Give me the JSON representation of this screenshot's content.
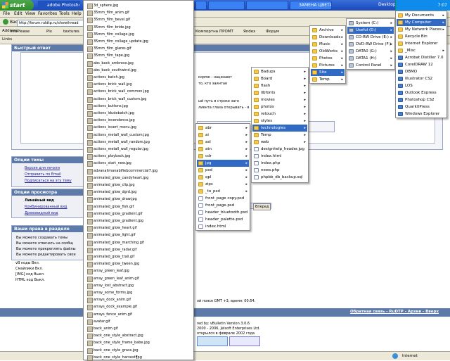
{
  "taskbar": {
    "start_label": "start",
    "buttons": [
      "adobe Photoshop",
      "",
      "",
      "",
      "ЗАМЕНА ЦВЕТА, что..."
    ],
    "desktop_label": "Desktop",
    "clock": "7:07"
  },
  "browser": {
    "menu": [
      "File",
      "Edit",
      "View",
      "Favorites",
      "Tools",
      "Help"
    ],
    "address_label": "Address",
    "address_value": "http://forum.ruldtp.ru/showthread",
    "back_label": "Back",
    "links_label": "Links",
    "links": [
      "infoPlease",
      "Pix",
      "textures",
      "Компортна",
      "ПРОМТ",
      "Яndex",
      "Форум"
    ],
    "status_text": "Internet"
  },
  "forum": {
    "quick_reply": "Быстрый ответ",
    "topic_options": "Опции темы",
    "topic_links": [
      "Версия для печати",
      "Отправить по Email",
      "Подписаться на эту тему"
    ],
    "view_options": "Опции просмотра",
    "view_links": [
      "Линейный вид",
      "Комбинированный вид",
      "Древовидный вид"
    ],
    "rights_title": "Ваши права в разделе",
    "rights": [
      "Вы можете создавать темы",
      "Вы можете отвечать на сообщ",
      "Вы можете прикреплять файлы",
      "Вы можете редактировать свои"
    ],
    "codes": [
      "vB коды Вкл.",
      "Смайлики Вкл.",
      "[IMG] код Выкл.",
      "HTML код Выкл."
    ],
    "text_fragment_1": "корпю - нацинают",
    "text_fragment_2": "то, кто заинтае",
    "text_fragment_3": "ый путь в строке заго",
    "text_fragment_4": "лиента глаза открывать - в",
    "go_button": "Вперед",
    "timezone": "ой поясе GMT +3, время: 00:54.",
    "footer_links": "Обратная связь - RuDTP - Архив - Вверх",
    "powered": "red by: vBulletin Version 3.0.6",
    "copyright": "2000 - 2006, Jelsoft Enterprises Ltd.",
    "opened": "открылся в феврале 2002 года"
  },
  "files": [
    "3d_sphere.jpg",
    "35mm_film_anim.gif",
    "35mm_film_bevel.gif",
    "35mm_film_bride.jpg",
    "35mm_film_collage.jpg",
    "35mm_film_collage_update.jpg",
    "35mm_film_glares.gif",
    "35mm_film_tape.jpg",
    "abs_back_ambroso.jpg",
    "abs_back_southwind.jpg",
    "actions_batch.jpg",
    "actions_brick_wall.jpg",
    "actions_brick_wall_common.jpg",
    "actions_brick_wall_custom.jpg",
    "actions_buttons.jpg",
    "actions_idudebatch.jpg",
    "actions_incendence.jpg",
    "actions_insert_menu.jpg",
    "actions_metall_wall_custom.jpg",
    "actions_metall_wall_random.jpg",
    "actions_metall_wall_regular.jpg",
    "actions_playback.jpg",
    "actions_start_new.jpg",
    "advanalimanabifiebcommercial7.jpg",
    "animated_glow_candyheart.jpg",
    "animated_glow_clip.jpg",
    "animated_glow_dgrd.jpg",
    "animated_glow_draw.jpg",
    "animated_glow_fish.gif",
    "animated_glow_gradient.gif",
    "animated_glow_gradient.jpg",
    "animated_glow_heart.gif",
    "animated_glow_light.gif",
    "animated_glow_marching.gif",
    "animated_glow_radar.gif",
    "animated_glow_trail.gif",
    "animated_glow_tween.jpg",
    "array_green_leaf.jpg",
    "array_green_leaf_anim.gif",
    "array_lost_abstract.jpg",
    "array_some_forms.jpg",
    "arrays_dock_anim.gif",
    "arrays_dock_example.gif",
    "arrays_fence_anim.gif",
    "avatar.gif",
    "back_anim.gif",
    "back_one_style_abstract.jpg",
    "back_one_style_frame_babe.jpg",
    "back_one_style_grass.jpg",
    "back_one_style_harvest.jpg"
  ],
  "menu_psfiles": [
    "abr",
    "ai",
    "asl",
    "atn",
    "cdr",
    "jpg",
    "psd",
    "qpl",
    "zips",
    "_to_psd",
    "front_page copy.psd",
    "front_page.psd",
    "header_bluetooth.psd",
    "header_palette.psd",
    "index.html"
  ],
  "menu_site": [
    "Badups",
    "Board",
    "flash",
    "libfonts",
    "movies",
    "photos",
    "retouch",
    "styles",
    "technologies",
    "Temp",
    "web",
    "designhelp_header.jpg",
    "index.html",
    "index.php",
    "news.php",
    "phpbb_db_backup.sql"
  ],
  "menu_useful": [
    "Archive",
    "Downloads",
    "Music",
    "OldWorks",
    "Photos",
    "Pictures",
    "Site",
    "Temp"
  ],
  "menu_drives": [
    "System (C:)",
    "Useful (D:)",
    "CD-RW Drive (E:)",
    "DVD-RW Drive (F:)",
    "DATA0 (G:)",
    "DATA1 (H:)",
    "Control Panel"
  ],
  "menu_start": [
    "My Documents",
    "My Computer",
    "My Network Places",
    "Recycle Bin",
    "Internet Explorer",
    "_Misc",
    "Acrobat Distiller 7.0",
    "CorelDRAW 12",
    "DBMO",
    "Illustrator CS2",
    "LOS",
    "Outlook Express",
    "Photoshop CS2",
    "QuarkXPress",
    "Windows Explorer"
  ]
}
